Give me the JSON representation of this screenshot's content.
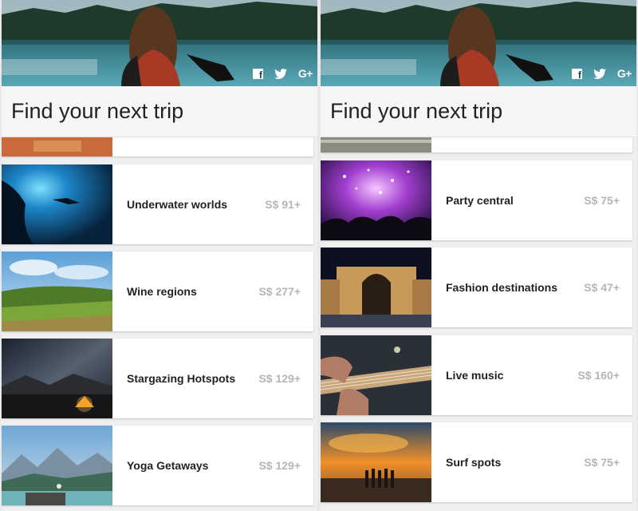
{
  "title": "Find your next trip",
  "social": [
    {
      "name": "facebook",
      "label": ""
    },
    {
      "name": "twitter",
      "label": ""
    },
    {
      "name": "google-plus",
      "label": "G+"
    }
  ],
  "left_list": [
    {
      "name": "Underwater worlds",
      "price": "S$ 91+"
    },
    {
      "name": "Wine regions",
      "price": "S$ 277+"
    },
    {
      "name": "Stargazing Hotspots",
      "price": "S$ 129+"
    },
    {
      "name": "Yoga Getaways",
      "price": "S$ 129+"
    }
  ],
  "right_list": [
    {
      "name": "Party central",
      "price": "S$ 75+"
    },
    {
      "name": "Fashion destinations",
      "price": "S$ 47+"
    },
    {
      "name": "Live music",
      "price": "S$ 160+"
    },
    {
      "name": "Surf spots",
      "price": "S$ 75+"
    }
  ]
}
